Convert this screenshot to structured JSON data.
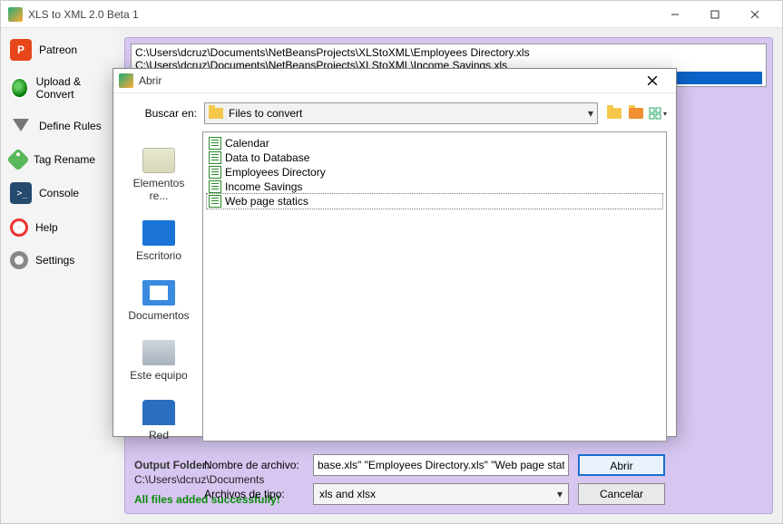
{
  "app": {
    "title": "XLS to XML 2.0 Beta 1"
  },
  "sidebar": {
    "items": [
      {
        "label": "Patreon"
      },
      {
        "label": "Upload & Convert"
      },
      {
        "label": "Define Rules"
      },
      {
        "label": "Tag Rename"
      },
      {
        "label": "Console"
      },
      {
        "label": "Help"
      },
      {
        "label": "Settings"
      }
    ]
  },
  "panel": {
    "files": [
      "C:\\Users\\dcruz\\Documents\\NetBeansProjects\\XLStoXML\\Employees Directory.xls",
      "C:\\Users\\dcruz\\Documents\\NetBeansProjects\\XLStoXML\\Income Savings.xls"
    ],
    "output_label": "Output Folder:",
    "output_path": "C:\\Users\\dcruz\\Documents",
    "success": "All files added successfully!"
  },
  "dialog": {
    "title": "Abrir",
    "lookin_label": "Buscar en:",
    "lookin_value": "Files to convert",
    "places": [
      {
        "label": "Elementos re..."
      },
      {
        "label": "Escritorio"
      },
      {
        "label": "Documentos"
      },
      {
        "label": "Este equipo"
      },
      {
        "label": "Red"
      }
    ],
    "files": [
      {
        "name": "Calendar"
      },
      {
        "name": "Data to Database"
      },
      {
        "name": "Employees Directory"
      },
      {
        "name": "Income Savings"
      },
      {
        "name": "Web page statics"
      }
    ],
    "selected_index": 4,
    "filename_label": "Nombre de archivo:",
    "filename_value": "base.xls\" \"Employees Directory.xls\" \"Web page statics.xls\"",
    "filetype_label": "Archivos de tipo:",
    "filetype_value": "xls and xlsx",
    "open_btn": "Abrir",
    "cancel_btn": "Cancelar"
  }
}
